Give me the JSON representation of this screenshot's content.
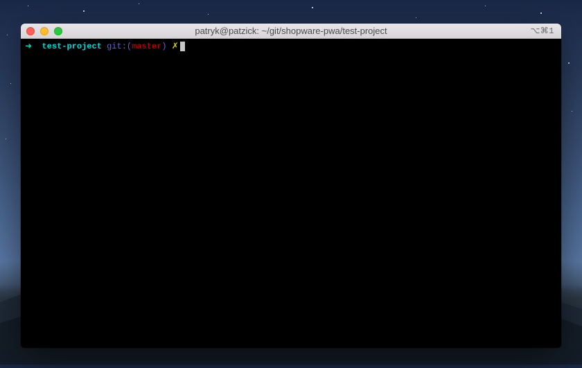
{
  "window": {
    "title": "patryk@patzick: ~/git/shopware-pwa/test-project",
    "titlebar_right": "⌥⌘1"
  },
  "traffic": {
    "close": "close",
    "minimize": "minimize",
    "zoom": "zoom"
  },
  "prompt": {
    "arrow": "➜",
    "directory": "test-project",
    "git_label": "git:(",
    "branch": "master",
    "git_close": ")",
    "dirty_symbol": "✗"
  }
}
